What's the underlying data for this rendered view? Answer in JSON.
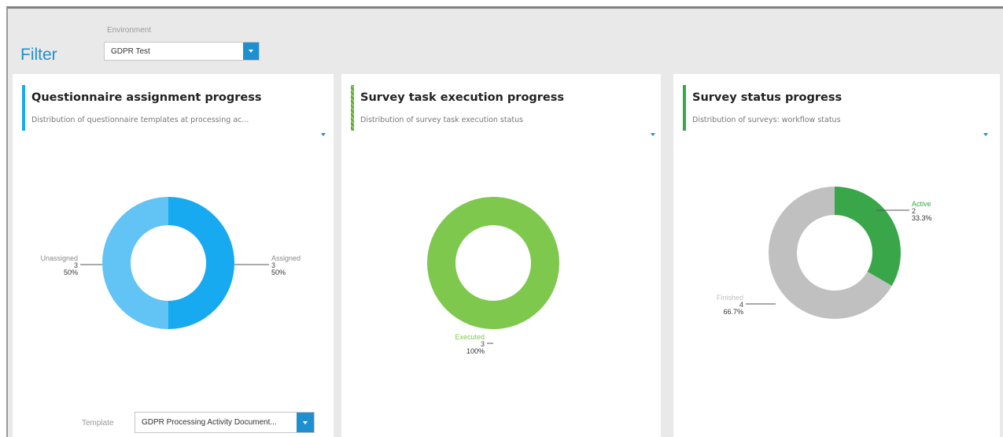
{
  "filter": {
    "title": "Filter",
    "environment_label": "Environment",
    "environment_value": "GDPR Test"
  },
  "colors": {
    "brand_blue": "#1e90d2",
    "assigned": "#18aaf0",
    "unassigned": "#62c3f5",
    "executed": "#7ec84e",
    "active": "#3aa64a",
    "finished": "#c0c0c0"
  },
  "cards": [
    {
      "title": "Questionnaire assignment progress",
      "subtitle": "Distribution of questionnaire templates at processing ac...",
      "template_label": "Template",
      "template_value": "GDPR Processing Activity Document...",
      "chart_data": {
        "type": "pie",
        "donut": true,
        "categories": [
          "Assigned",
          "Unassigned"
        ],
        "values": [
          3,
          3
        ],
        "labels": [
          {
            "name": "Assigned",
            "count": "3",
            "percent": "50%"
          },
          {
            "name": "Unassigned",
            "count": "3",
            "percent": "50%"
          }
        ],
        "colors": [
          "#18aaf0",
          "#62c3f5"
        ]
      }
    },
    {
      "title": "Survey task execution progress",
      "subtitle": "Distribution of survey task execution status",
      "chart_data": {
        "type": "pie",
        "donut": true,
        "categories": [
          "Executed"
        ],
        "values": [
          3
        ],
        "labels": [
          {
            "name": "Executed",
            "count": "3",
            "percent": "100%"
          }
        ],
        "colors": [
          "#7ec84e"
        ]
      }
    },
    {
      "title": "Survey status progress",
      "subtitle": "Distribution of surveys: workflow status",
      "chart_data": {
        "type": "pie",
        "donut": true,
        "categories": [
          "Active",
          "Finished"
        ],
        "values": [
          2,
          4
        ],
        "labels": [
          {
            "name": "Active",
            "count": "2",
            "percent": "33.3%"
          },
          {
            "name": "Finished",
            "count": "4",
            "percent": "66.7%"
          }
        ],
        "colors": [
          "#3aa64a",
          "#c0c0c0"
        ]
      }
    }
  ]
}
